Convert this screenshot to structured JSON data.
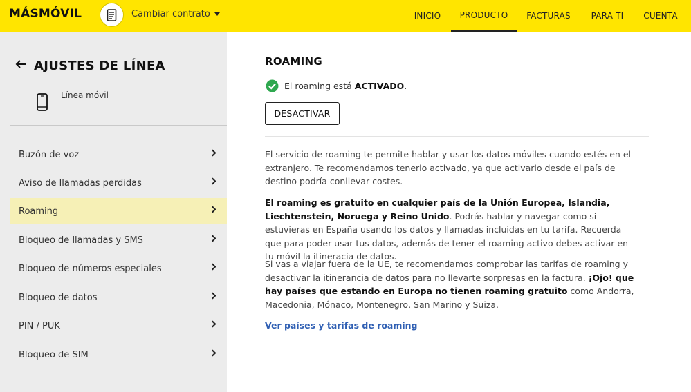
{
  "header": {
    "logo": "MÁSMÓVIL",
    "contract_label": "Cambiar contrato",
    "nav": [
      {
        "label": "INICIO",
        "active": false
      },
      {
        "label": "PRODUCTO",
        "active": true
      },
      {
        "label": "FACTURAS",
        "active": false
      },
      {
        "label": "PARA TI",
        "active": false
      },
      {
        "label": "CUENTA",
        "active": false
      }
    ]
  },
  "sidebar": {
    "title": "AJUSTES DE LÍNEA",
    "line_label": "Línea móvil",
    "items": [
      {
        "label": "Buzón de voz",
        "active": false
      },
      {
        "label": "Aviso de llamadas perdidas",
        "active": false
      },
      {
        "label": "Roaming",
        "active": true
      },
      {
        "label": "Bloqueo de llamadas y SMS",
        "active": false
      },
      {
        "label": "Bloqueo de números especiales",
        "active": false
      },
      {
        "label": "Bloqueo de datos",
        "active": false
      },
      {
        "label": "PIN / PUK",
        "active": false
      },
      {
        "label": "Bloqueo de SIM",
        "active": false
      }
    ]
  },
  "main": {
    "title": "ROAMING",
    "status_prefix": "El roaming está ",
    "status_value": "ACTIVADO",
    "status_suffix": ".",
    "button_label": "DESACTIVAR",
    "para1": "El servicio de roaming te permite hablar y usar los datos móviles cuando estés en el extranjero. Te recomendamos tenerlo activado, ya que activarlo desde el país de destino podría conllevar costes.",
    "para2_bold": "El roaming es gratuito en cualquier país de la Unión Europea, Islandia, Liechtenstein, Noruega y Reino Unido",
    "para2_rest": ". Podrás hablar y navegar como si estuvieras en España usando los datos y llamadas incluidas en tu tarifa. Recuerda que para poder usar tus datos, además de tener el roaming activo debes activar en tu móvil la itineracia de datos.",
    "para3_start": "Si vas a viajar fuera de la UE, te recomendamos comprobar las tarifas de roaming y desactivar la itinerancia de datos para no llevarte sorpresas en la factura. ",
    "para3_bold": "¡Ojo! que hay países que estando en Europa no tienen roaming gratuito",
    "para3_end": " como Andorra, Macedonia, Mónaco, Montenegro, San Marino y Suiza.",
    "link": "Ver países y tarifas de roaming"
  },
  "colors": {
    "brand_yellow": "#ffe500",
    "active_item_bg": "#f6f0b6",
    "success_green": "#2fa84f",
    "link_blue": "#2f5fb3"
  },
  "icons": {
    "contract": "document-icon",
    "back": "arrow-left-icon",
    "line": "mobile-phone-icon",
    "status": "check-circle-icon",
    "menu": "chevron-right-icon"
  }
}
